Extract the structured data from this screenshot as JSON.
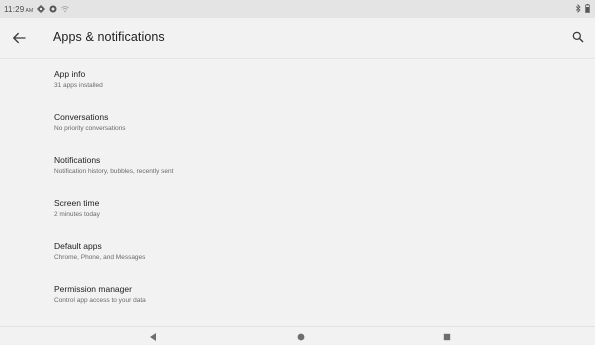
{
  "status_bar": {
    "time": "11:29",
    "ampm": "AM",
    "left_icons": [
      "settings-gear-icon",
      "shield-icon",
      "wifi-icon"
    ],
    "right_icons": [
      "bluetooth-icon",
      "battery-icon"
    ]
  },
  "app_bar": {
    "title": "Apps & notifications",
    "back_icon": "arrow-back-icon",
    "search_icon": "search-icon"
  },
  "settings": {
    "items": [
      {
        "title": "App info",
        "subtitle": "31 apps installed"
      },
      {
        "title": "Conversations",
        "subtitle": "No priority conversations"
      },
      {
        "title": "Notifications",
        "subtitle": "Notification history, bubbles, recently sent"
      },
      {
        "title": "Screen time",
        "subtitle": "2 minutes today"
      },
      {
        "title": "Default apps",
        "subtitle": "Chrome, Phone, and Messages"
      },
      {
        "title": "Permission manager",
        "subtitle": "Control app access to your data"
      }
    ]
  },
  "nav_bar": {
    "buttons": [
      "back-triangle-icon",
      "home-circle-icon",
      "recents-square-icon"
    ]
  },
  "colors": {
    "background": "#f2f2f2",
    "status_bar": "#e4e4e4",
    "title_text": "#202124",
    "subtitle_text": "#6b6b6b"
  }
}
